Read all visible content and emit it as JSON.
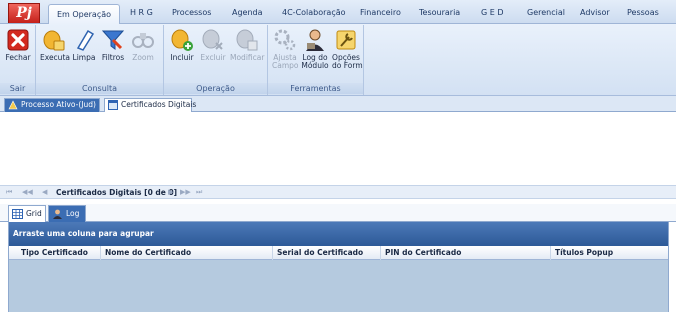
{
  "app": {
    "logo_text": "Pj"
  },
  "menu_tabs": [
    {
      "label": "Em Operação",
      "active": true
    },
    {
      "label": "H R G"
    },
    {
      "label": "Processos"
    },
    {
      "label": "Agenda"
    },
    {
      "label": "4C-Colaboração"
    },
    {
      "label": "Financeiro"
    },
    {
      "label": "Tesouraria"
    },
    {
      "label": "G E D"
    },
    {
      "label": "Gerencial"
    },
    {
      "label": "Advisor"
    },
    {
      "label": "Pessoas"
    }
  ],
  "ribbon": {
    "groups": [
      {
        "label": "Sair",
        "buttons": [
          {
            "label": "Fechar",
            "icon": "close-icon"
          }
        ]
      },
      {
        "label": "Consulta",
        "buttons": [
          {
            "label": "Executa",
            "icon": "execute-icon"
          },
          {
            "label": "Limpa",
            "icon": "eraser-icon"
          },
          {
            "label": "Filtros",
            "icon": "filter-icon"
          },
          {
            "label": "Zoom",
            "icon": "binoculars-icon",
            "disabled": true
          }
        ]
      },
      {
        "label": "Operação",
        "buttons": [
          {
            "label": "Incluir",
            "icon": "add-icon"
          },
          {
            "label": "Excluir",
            "icon": "delete-icon",
            "disabled": true
          },
          {
            "label": "Modificar",
            "icon": "edit-icon",
            "disabled": true
          }
        ]
      },
      {
        "label": "Ferramentas",
        "buttons": [
          {
            "label_line1": "Ajusta",
            "label_line2": "Campo",
            "icon": "gears-icon",
            "disabled": true
          },
          {
            "label_line1": "Log do",
            "label_line2": "Módulo",
            "icon": "user-log-icon"
          },
          {
            "label_line1": "Opções",
            "label_line2": "do Form",
            "icon": "wrench-icon"
          }
        ]
      }
    ]
  },
  "doc_tabs": [
    {
      "label": "Processo Ativo-(Jud)",
      "active": true
    },
    {
      "label": "Certificados Digitais"
    }
  ],
  "navigator": {
    "first": "⏮",
    "prev_page": "◀◀",
    "prev": "◀",
    "text": "Certificados Digitais [0 de 0]",
    "next": "▶",
    "next_page": "▶▶",
    "last": "⏭"
  },
  "sub_tabs": [
    {
      "label": "Grid"
    },
    {
      "label": "Log",
      "active": true
    }
  ],
  "grid": {
    "group_panel_text": "Arraste uma coluna para agrupar",
    "columns": [
      "Tipo Certificado",
      "Nome do Certificado",
      "Serial do Certificado",
      "PIN do Certificado",
      "Títulos Popup"
    ]
  }
}
